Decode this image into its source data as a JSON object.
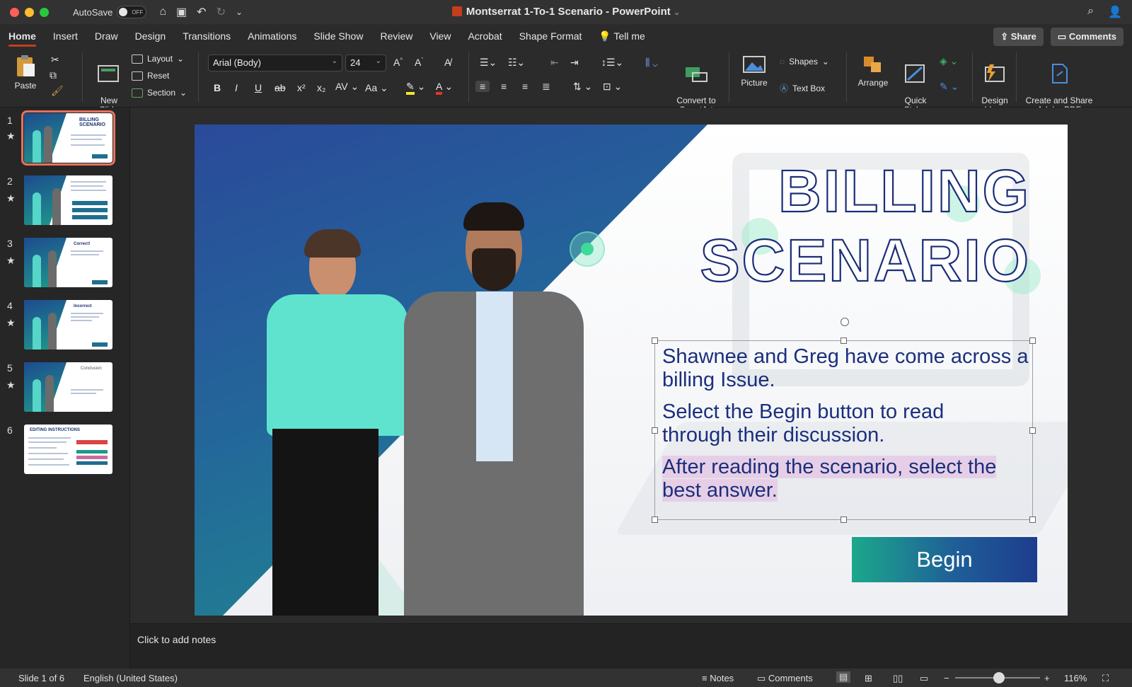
{
  "titlebar": {
    "autosave_label": "AutoSave",
    "autosave_state": "OFF",
    "document_title": "Montserrat 1-To-1 Scenario - PowerPoint"
  },
  "tabs": [
    "Home",
    "Insert",
    "Draw",
    "Design",
    "Transitions",
    "Animations",
    "Slide Show",
    "Review",
    "View",
    "Acrobat",
    "Shape Format"
  ],
  "tell_me": "Tell me",
  "share_label": "Share",
  "comments_label": "Comments",
  "ribbon": {
    "paste": "Paste",
    "new_slide": "New\nSlide",
    "layout": "Layout",
    "reset": "Reset",
    "section": "Section",
    "font_name": "Arial (Body)",
    "font_size": "24",
    "convert_smartart": "Convert to\nSmartArt",
    "picture": "Picture",
    "shapes": "Shapes",
    "text_box": "Text Box",
    "arrange": "Arrange",
    "quick_styles": "Quick\nStyles",
    "design_ideas": "Design\nIdeas",
    "adobe_pdf": "Create and Share\nAdobe PDF"
  },
  "thumbnails": [
    {
      "num": "1",
      "starred": true,
      "title": "BILLING SCENARIO",
      "selected": true
    },
    {
      "num": "2",
      "starred": true,
      "title": "",
      "selected": false
    },
    {
      "num": "3",
      "starred": true,
      "title": "Correct!",
      "selected": false
    },
    {
      "num": "4",
      "starred": true,
      "title": "Incorrect",
      "selected": false
    },
    {
      "num": "5",
      "starred": true,
      "title": "Conclusion",
      "selected": false
    },
    {
      "num": "6",
      "starred": false,
      "title": "EDITING INSTRUCTIONS",
      "selected": false
    }
  ],
  "slide": {
    "title_line1": "BILLING",
    "title_line2": "SCENARIO",
    "para1": "Shawnee and Greg have come across a billing Issue.",
    "para2": "Select the Begin button to read through their discussion.",
    "para3": "After reading the scenario, select the best answer.",
    "begin_button": "Begin"
  },
  "notes_placeholder": "Click to add notes",
  "status": {
    "slide_info": "Slide 1 of 6",
    "language": "English (United States)",
    "notes": "Notes",
    "comments": "Comments",
    "zoom": "116%"
  },
  "colors": {
    "accent": "#c43e1c",
    "slide_title_outline": "#1a2d78",
    "slide_text": "#1b2f7d",
    "highlight": "#e6cfe6"
  }
}
